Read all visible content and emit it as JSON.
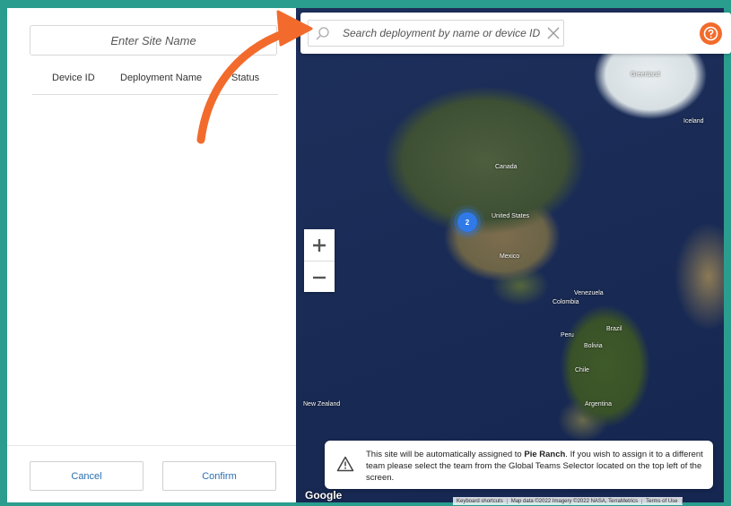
{
  "left_panel": {
    "site_name_placeholder": "Enter Site Name",
    "columns": [
      "Device ID",
      "Deployment Name",
      "Status"
    ],
    "cancel_label": "Cancel",
    "confirm_label": "Confirm"
  },
  "search": {
    "placeholder": "Search deployment by name or device ID"
  },
  "map": {
    "cluster_count": "2",
    "labels": [
      {
        "name": "Greenland",
        "cls": "l-greenland"
      },
      {
        "name": "Iceland",
        "cls": "l-iceland"
      },
      {
        "name": "Canada",
        "cls": "l-canada"
      },
      {
        "name": "United States",
        "cls": "l-us"
      },
      {
        "name": "Mexico",
        "cls": "l-mexico"
      },
      {
        "name": "Venezuela",
        "cls": "l-venezuela"
      },
      {
        "name": "Colombia",
        "cls": "l-colombia"
      },
      {
        "name": "Brazil",
        "cls": "l-brazil"
      },
      {
        "name": "Peru",
        "cls": "l-peru"
      },
      {
        "name": "Bolivia",
        "cls": "l-bolivia"
      },
      {
        "name": "Chile",
        "cls": "l-chile"
      },
      {
        "name": "Argentina",
        "cls": "l-argentina"
      },
      {
        "name": "New Zealand",
        "cls": "l-nz"
      }
    ],
    "google_logo": "Google",
    "attribution": {
      "keyboard": "Keyboard shortcuts",
      "mapdata": "Map data ©2022 Imagery ©2022 NASA, TerraMetrics",
      "terms": "Terms of Use"
    }
  },
  "toast": {
    "text_before": "This site will be automatically assigned to ",
    "team": "Pie Ranch",
    "text_after": ". If you wish to assign it to a different team please select the team from the Global Teams Selector located on the top left of the screen."
  },
  "colors": {
    "accent": "#f26b2c",
    "frame": "#2a9d8f",
    "link": "#2a6fb0"
  }
}
